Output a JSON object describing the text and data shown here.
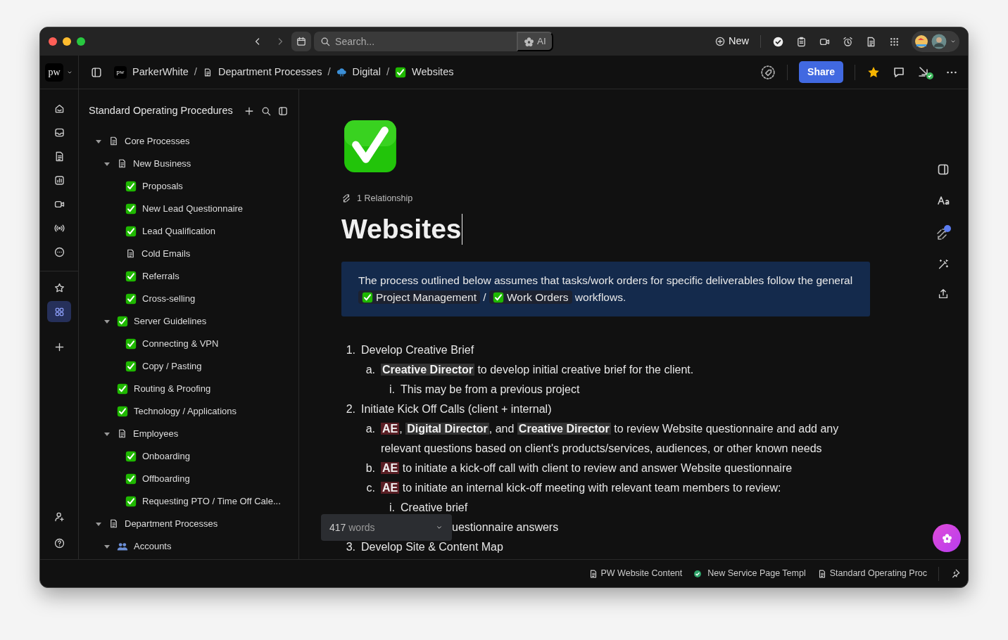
{
  "titlebar": {
    "search": {
      "placeholder": "Search..."
    },
    "ai_label": "AI",
    "new_label": "New"
  },
  "breadcrumb": {
    "logo": "pw",
    "items": [
      {
        "kind": "workspace",
        "logo": "pw",
        "label": "ParkerWhite"
      },
      {
        "kind": "doc",
        "separator": "/",
        "label": "Department Processes"
      },
      {
        "kind": "cloud",
        "separator": "/",
        "label": "Digital"
      },
      {
        "kind": "check",
        "separator": "/",
        "label": "Websites"
      }
    ],
    "share": "Share"
  },
  "rail": {
    "items": [
      {
        "selected": false
      },
      {
        "selected": false
      },
      {
        "selected": false
      },
      {
        "selected": false
      },
      {
        "selected": false
      },
      {
        "selected": false
      },
      {
        "selected": false
      },
      {
        "selected": false
      },
      {
        "selected": true
      }
    ]
  },
  "sidebar": {
    "title": "Standard Operating Procedures",
    "tree": [
      {
        "label": "Core Processes",
        "kind": "doc",
        "expanded": true,
        "children": [
          {
            "label": "New Business",
            "kind": "doc",
            "expanded": true,
            "children": [
              {
                "label": "Proposals",
                "kind": "check"
              },
              {
                "label": "New Lead Questionnaire",
                "kind": "check"
              },
              {
                "label": "Lead Qualification",
                "kind": "check"
              },
              {
                "label": "Cold Emails",
                "kind": "doc"
              },
              {
                "label": "Referrals",
                "kind": "check"
              },
              {
                "label": "Cross-selling",
                "kind": "check"
              }
            ]
          },
          {
            "label": "Server Guidelines",
            "kind": "check",
            "expanded": true,
            "children": [
              {
                "label": "Connecting & VPN",
                "kind": "check"
              },
              {
                "label": "Copy / Pasting",
                "kind": "check"
              }
            ]
          },
          {
            "label": "Routing & Proofing",
            "kind": "check"
          },
          {
            "label": "Technology / Applications",
            "kind": "check"
          },
          {
            "label": "Employees",
            "kind": "doc",
            "expanded": true,
            "children": [
              {
                "label": "Onboarding",
                "kind": "check"
              },
              {
                "label": "Offboarding",
                "kind": "check"
              },
              {
                "label": "Requesting PTO / Time Off Cale...",
                "kind": "check"
              }
            ]
          }
        ]
      },
      {
        "label": "Department Processes",
        "kind": "doc",
        "expanded": true,
        "children": [
          {
            "label": "Accounts",
            "kind": "people",
            "expanded": true
          }
        ]
      }
    ]
  },
  "page": {
    "relationship": "1 Relationship",
    "title": "Websites",
    "callout": [
      {
        "kind": "text",
        "text": "The process outlined below assumes that tasks/work orders for specific deliverables follow the general"
      },
      {
        "kind": "chip",
        "text": "Project Management"
      },
      {
        "kind": "text",
        "text": "/"
      },
      {
        "kind": "chip",
        "text": "Work Orders"
      },
      {
        "kind": "text",
        "text": "workflows."
      }
    ],
    "list": [
      {
        "marker": "1.",
        "parts": [
          {
            "text": "Develop Creative Brief"
          }
        ],
        "children": [
          {
            "marker": "a.",
            "parts": [
              {
                "text": "Creative Director",
                "kind": "role"
              },
              {
                "text": " to develop initial creative brief for the client."
              }
            ],
            "children": [
              {
                "marker": "i.",
                "parts": [
                  {
                    "text": "This may be from a previous project"
                  }
                ]
              }
            ]
          }
        ]
      },
      {
        "marker": "2.",
        "parts": [
          {
            "text": "Initiate Kick Off Calls (client + internal)"
          }
        ],
        "children": [
          {
            "marker": "a.",
            "parts": [
              {
                "text": "AE",
                "kind": "owner"
              },
              {
                "text": ", "
              },
              {
                "text": "Digital Director",
                "kind": "role"
              },
              {
                "text": ", and "
              },
              {
                "text": "Creative Director",
                "kind": "role"
              },
              {
                "text": " to review Website questionnaire and add any relevant questions based on client's products/services, audiences, or other known needs"
              }
            ]
          },
          {
            "marker": "b.",
            "parts": [
              {
                "text": "AE",
                "kind": "owner"
              },
              {
                "text": " to initiate a kick-off call with client to review and answer Website questionnaire"
              }
            ]
          },
          {
            "marker": "c.",
            "parts": [
              {
                "text": "AE",
                "kind": "owner"
              },
              {
                "text": " to initiate an internal kick-off meeting with relevant team members to review:"
              }
            ],
            "children": [
              {
                "marker": "i.",
                "parts": [
                  {
                    "text": "Creative brief"
                  }
                ]
              },
              {
                "parts": [
                  {
                    "text": "uestionnaire answers"
                  }
                ]
              }
            ]
          }
        ]
      },
      {
        "marker": "3.",
        "parts": [
          {
            "text": "Develop Site & Content Map"
          }
        ]
      }
    ],
    "word_count": {
      "number": "417",
      "unit": "words"
    }
  },
  "bottom_tabs": [
    {
      "kind": "doc",
      "label": "PW Website Content"
    },
    {
      "kind": "done",
      "label": "New Service Page Templ"
    },
    {
      "kind": "doc",
      "label": "Standard Operating Proc"
    }
  ]
}
